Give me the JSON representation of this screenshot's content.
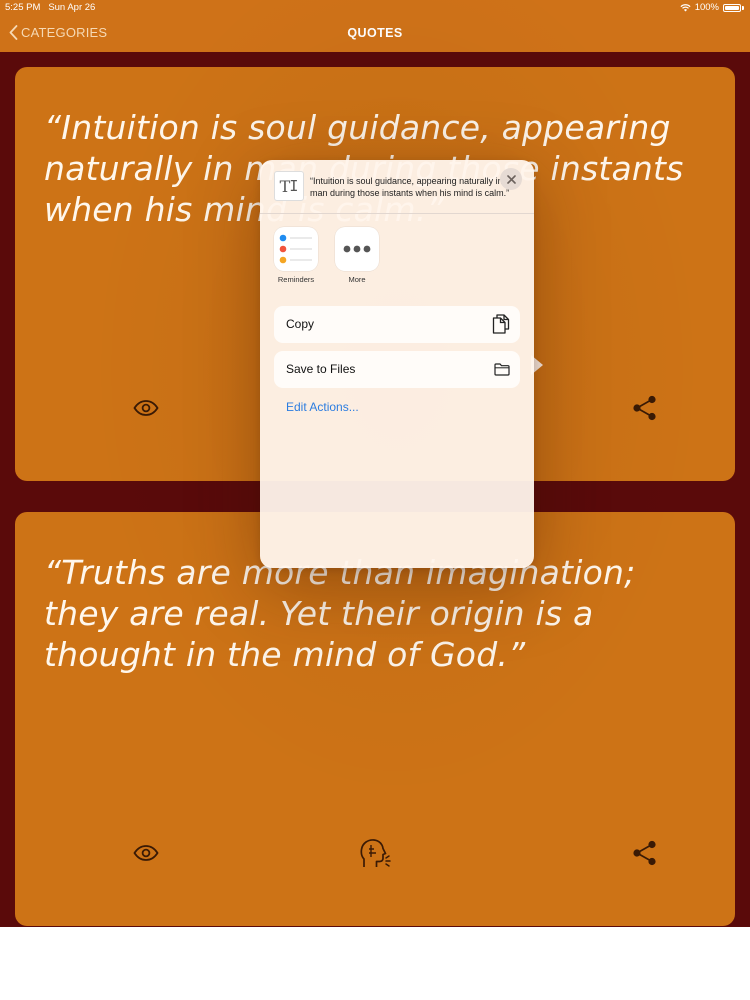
{
  "status_bar": {
    "time": "5:25 PM",
    "date": "Sun Apr 26",
    "battery": "100%"
  },
  "nav": {
    "back_label": "CATEGORIES",
    "title": "QUOTES"
  },
  "quotes": [
    {
      "text": "“Intuition is soul guidance, appearing naturally in man during those instants when his mind is calm.”"
    },
    {
      "text": "“Truths are more than imagination; they are real. Yet their origin is a thought in the mind of God.”"
    }
  ],
  "share_sheet": {
    "preview_text": "“Intuition is soul guidance, appearing naturally in man during those instants when his mind is calm.”",
    "apps": [
      {
        "label": "Reminders",
        "icon": "reminders-icon"
      },
      {
        "label": "More",
        "icon": "more-icon"
      }
    ],
    "actions": [
      {
        "label": "Copy",
        "icon": "copy-icon"
      },
      {
        "label": "Save to Files",
        "icon": "folder-icon"
      }
    ],
    "edit_actions_label": "Edit Actions..."
  },
  "colors": {
    "nav_bar": "#cf7218",
    "card": "#cd7316",
    "background": "#5a0a0a",
    "link": "#2c7de0"
  }
}
